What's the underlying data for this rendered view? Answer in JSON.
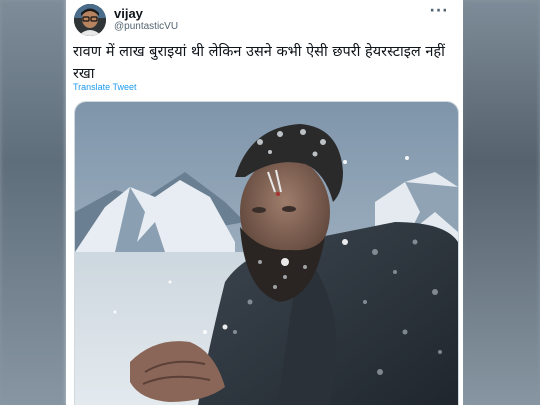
{
  "tweet": {
    "author": {
      "display_name": "vijay",
      "handle": "@puntasticVU"
    },
    "more_icon": "more-horizontal-icon",
    "text": "रावण में लाख बुराइयां थी लेकिन उसने कभी ऐसी छपरी हेयरस्टाइल नहीं रखा",
    "translate_label": "Translate Tweet",
    "colors": {
      "link": "#1d9bf0",
      "text": "#0f1419",
      "muted": "#536471"
    }
  }
}
